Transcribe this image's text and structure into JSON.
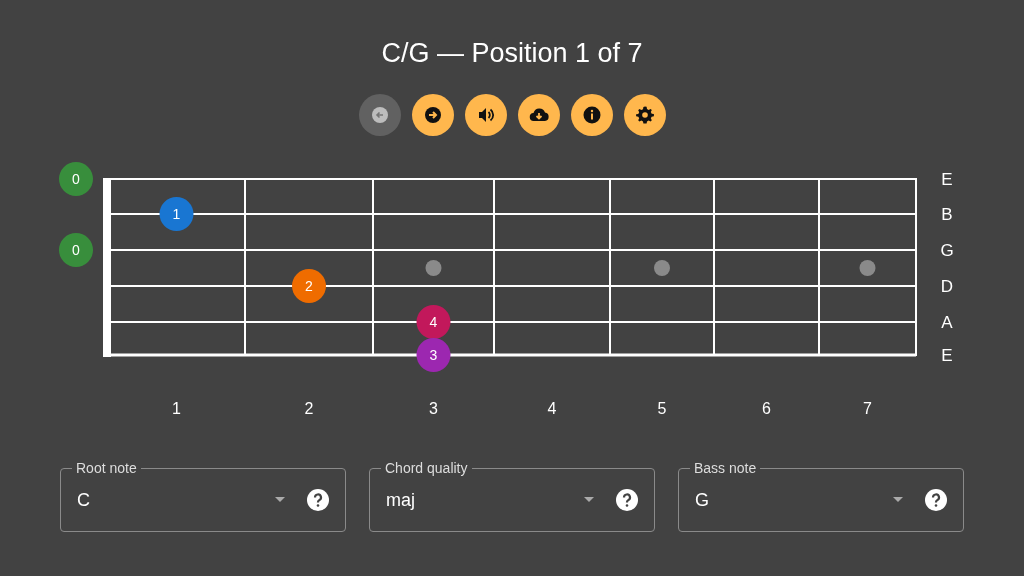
{
  "title": "C/G — Position 1 of 7",
  "toolbar": [
    {
      "kind": "back",
      "disabled": true
    },
    {
      "kind": "next",
      "disabled": false
    },
    {
      "kind": "sound",
      "disabled": false
    },
    {
      "kind": "download",
      "disabled": false
    },
    {
      "kind": "info",
      "disabled": false
    },
    {
      "kind": "settings",
      "disabled": false
    }
  ],
  "fretboard": {
    "strings": [
      {
        "label": "E",
        "open": {
          "finger": "0",
          "color": "#388e3c"
        },
        "cells": [
          null,
          null,
          null,
          null,
          null,
          null,
          null
        ]
      },
      {
        "label": "B",
        "cells": [
          {
            "finger": "1",
            "color": "#1976d2"
          },
          null,
          null,
          null,
          null,
          null,
          null
        ]
      },
      {
        "label": "G",
        "open": {
          "finger": "0",
          "color": "#388e3c"
        },
        "cells": [
          null,
          null,
          null,
          null,
          null,
          null,
          null
        ]
      },
      {
        "label": "D",
        "cells": [
          null,
          {
            "finger": "2",
            "color": "#ef6c00"
          },
          null,
          null,
          null,
          null,
          null
        ]
      },
      {
        "label": "A",
        "cells": [
          null,
          null,
          {
            "finger": "4",
            "color": "#c2185b"
          },
          null,
          null,
          null,
          null
        ]
      },
      {
        "label": "E",
        "cells": [
          null,
          null,
          {
            "finger": "3",
            "color": "#9c27b0"
          },
          null,
          null,
          null,
          null
        ]
      }
    ],
    "frets": [
      "1",
      "2",
      "3",
      "4",
      "5",
      "6",
      "7"
    ]
  },
  "selects": [
    {
      "label": "Root note",
      "value": "C"
    },
    {
      "label": "Chord quality",
      "value": "maj"
    },
    {
      "label": "Bass note",
      "value": "G"
    }
  ]
}
